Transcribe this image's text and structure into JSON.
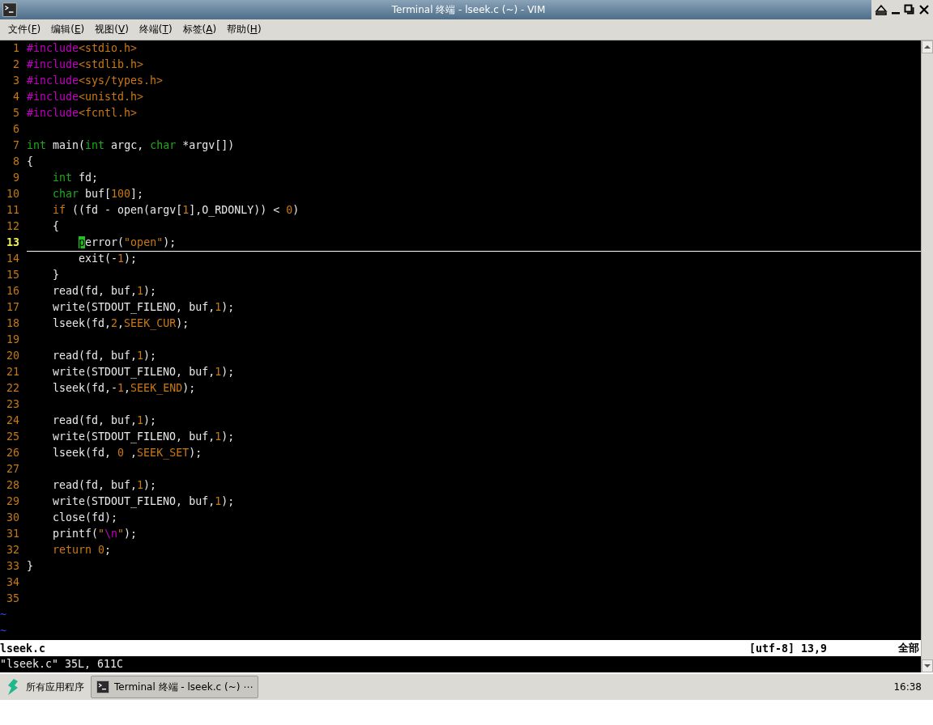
{
  "window": {
    "title": "Terminal 终端 - lseek.c (~) - VIM"
  },
  "menu": [
    {
      "before": "文件(",
      "key": "F",
      "after": ")"
    },
    {
      "before": "编辑(",
      "key": "E",
      "after": ")"
    },
    {
      "before": "视图(",
      "key": "V",
      "after": ")"
    },
    {
      "before": "终端(",
      "key": "T",
      "after": ")"
    },
    {
      "before": "标签(",
      "key": "A",
      "after": ")"
    },
    {
      "before": "帮助(",
      "key": "H",
      "after": ")"
    }
  ],
  "editor": {
    "lines": [
      {
        "number": "1",
        "current": false,
        "tokens": [
          {
            "text": "#include",
            "kind": "preproc"
          },
          {
            "text": "<stdio.h>",
            "kind": "string"
          }
        ]
      },
      {
        "number": "2",
        "current": false,
        "tokens": [
          {
            "text": "#include",
            "kind": "preproc"
          },
          {
            "text": "<stdlib.h>",
            "kind": "string"
          }
        ]
      },
      {
        "number": "3",
        "current": false,
        "tokens": [
          {
            "text": "#include",
            "kind": "preproc"
          },
          {
            "text": "<sys/types.h>",
            "kind": "string"
          }
        ]
      },
      {
        "number": "4",
        "current": false,
        "tokens": [
          {
            "text": "#include",
            "kind": "preproc"
          },
          {
            "text": "<unistd.h>",
            "kind": "string"
          }
        ]
      },
      {
        "number": "5",
        "current": false,
        "tokens": [
          {
            "text": "#include",
            "kind": "preproc"
          },
          {
            "text": "<fcntl.h>",
            "kind": "string"
          }
        ]
      },
      {
        "number": "6",
        "current": false
      },
      {
        "number": "7",
        "current": false,
        "tokens": [
          {
            "text": "int",
            "kind": "type"
          },
          {
            "text": " main(",
            "kind": "plain"
          },
          {
            "text": "int",
            "kind": "type"
          },
          {
            "text": " argc, ",
            "kind": "plain"
          },
          {
            "text": "char",
            "kind": "type"
          },
          {
            "text": " *argv[])",
            "kind": "plain"
          }
        ]
      },
      {
        "number": "8",
        "current": false,
        "tokens": [
          {
            "text": "{",
            "kind": "plain"
          }
        ]
      },
      {
        "number": "9",
        "current": false,
        "tokens": [
          {
            "text": "    int",
            "kind": "type"
          },
          {
            "text": " fd;",
            "kind": "plain"
          }
        ]
      },
      {
        "number": "10",
        "current": false,
        "tokens": [
          {
            "text": "    char",
            "kind": "type"
          },
          {
            "text": " buf[",
            "kind": "plain"
          },
          {
            "text": "100",
            "kind": "number"
          },
          {
            "text": "];",
            "kind": "plain"
          }
        ]
      },
      {
        "number": "11",
        "current": false,
        "tokens": [
          {
            "text": "    if",
            "kind": "statement"
          },
          {
            "text": " ((fd - open(argv[",
            "kind": "plain"
          },
          {
            "text": "1",
            "kind": "number"
          },
          {
            "text": "],O_RDONLY)) < ",
            "kind": "plain"
          },
          {
            "text": "0",
            "kind": "number"
          },
          {
            "text": ")",
            "kind": "plain"
          }
        ]
      },
      {
        "number": "12",
        "current": false,
        "tokens": [
          {
            "text": "    {",
            "kind": "plain"
          }
        ]
      },
      {
        "number": "13",
        "current": true,
        "tokens": [
          {
            "text": "        p",
            "kind": "cursor"
          },
          {
            "text": "error(",
            "kind": "plain"
          },
          {
            "text": "\"open\"",
            "kind": "string"
          },
          {
            "text": ");",
            "kind": "plain"
          }
        ]
      },
      {
        "number": "14",
        "current": false,
        "tokens": [
          {
            "text": "        exit(-",
            "kind": "plain"
          },
          {
            "text": "1",
            "kind": "number"
          },
          {
            "text": ");",
            "kind": "plain"
          }
        ]
      },
      {
        "number": "15",
        "current": false,
        "tokens": [
          {
            "text": "    }",
            "kind": "plain"
          }
        ]
      },
      {
        "number": "16",
        "current": false,
        "tokens": [
          {
            "text": "    read(fd, buf,",
            "kind": "plain"
          },
          {
            "text": "1",
            "kind": "number"
          },
          {
            "text": ");",
            "kind": "plain"
          }
        ]
      },
      {
        "number": "17",
        "current": false,
        "tokens": [
          {
            "text": "    write(STDOUT_FILENO, buf,",
            "kind": "plain"
          },
          {
            "text": "1",
            "kind": "number"
          },
          {
            "text": ");",
            "kind": "plain"
          }
        ]
      },
      {
        "number": "18",
        "current": false,
        "tokens": [
          {
            "text": "    lseek(fd,",
            "kind": "plain"
          },
          {
            "text": "2",
            "kind": "number"
          },
          {
            "text": ",",
            "kind": "plain"
          },
          {
            "text": "SEEK_CUR",
            "kind": "constant"
          },
          {
            "text": ");",
            "kind": "plain"
          }
        ]
      },
      {
        "number": "19",
        "current": false
      },
      {
        "number": "20",
        "current": false,
        "tokens": [
          {
            "text": "    read(fd, buf,",
            "kind": "plain"
          },
          {
            "text": "1",
            "kind": "number"
          },
          {
            "text": ");",
            "kind": "plain"
          }
        ]
      },
      {
        "number": "21",
        "current": false,
        "tokens": [
          {
            "text": "    write(STDOUT_FILENO, buf,",
            "kind": "plain"
          },
          {
            "text": "1",
            "kind": "number"
          },
          {
            "text": ");",
            "kind": "plain"
          }
        ]
      },
      {
        "number": "22",
        "current": false,
        "tokens": [
          {
            "text": "    lseek(fd,-",
            "kind": "plain"
          },
          {
            "text": "1",
            "kind": "number"
          },
          {
            "text": ",",
            "kind": "plain"
          },
          {
            "text": "SEEK_END",
            "kind": "constant"
          },
          {
            "text": ");",
            "kind": "plain"
          }
        ]
      },
      {
        "number": "23",
        "current": false
      },
      {
        "number": "24",
        "current": false,
        "tokens": [
          {
            "text": "    read(fd, buf,",
            "kind": "plain"
          },
          {
            "text": "1",
            "kind": "number"
          },
          {
            "text": ");",
            "kind": "plain"
          }
        ]
      },
      {
        "number": "25",
        "current": false,
        "tokens": [
          {
            "text": "    write(STDOUT_FILENO, buf,",
            "kind": "plain"
          },
          {
            "text": "1",
            "kind": "number"
          },
          {
            "text": ");",
            "kind": "plain"
          }
        ]
      },
      {
        "number": "26",
        "current": false,
        "tokens": [
          {
            "text": "    lseek(fd, ",
            "kind": "plain"
          },
          {
            "text": "0",
            "kind": "number"
          },
          {
            "text": " ,",
            "kind": "plain"
          },
          {
            "text": "SEEK_SET",
            "kind": "constant"
          },
          {
            "text": ");",
            "kind": "plain"
          }
        ]
      },
      {
        "number": "27",
        "current": false
      },
      {
        "number": "28",
        "current": false,
        "tokens": [
          {
            "text": "    read(fd, buf,",
            "kind": "plain"
          },
          {
            "text": "1",
            "kind": "number"
          },
          {
            "text": ");",
            "kind": "plain"
          }
        ]
      },
      {
        "number": "29",
        "current": false,
        "tokens": [
          {
            "text": "    write(STDOUT_FILENO, buf,",
            "kind": "plain"
          },
          {
            "text": "1",
            "kind": "number"
          },
          {
            "text": ");",
            "kind": "plain"
          }
        ]
      },
      {
        "number": "30",
        "current": false,
        "tokens": [
          {
            "text": "    close(fd);",
            "kind": "plain"
          }
        ]
      },
      {
        "number": "31",
        "current": false,
        "tokens": [
          {
            "text": "    printf(",
            "kind": "plain"
          },
          {
            "text": "\"",
            "kind": "string"
          },
          {
            "text": "\\n",
            "kind": "special"
          },
          {
            "text": "\"",
            "kind": "string"
          },
          {
            "text": ");",
            "kind": "plain"
          }
        ]
      },
      {
        "number": "32",
        "current": false,
        "tokens": [
          {
            "text": "    return",
            "kind": "statement"
          },
          {
            "text": " 0",
            "kind": "number"
          },
          {
            "text": ";",
            "kind": "plain"
          }
        ]
      },
      {
        "number": "33",
        "current": false,
        "tokens": [
          {
            "text": "}",
            "kind": "plain"
          }
        ]
      },
      {
        "number": "34",
        "current": false
      },
      {
        "number": "35",
        "current": false
      }
    ],
    "filler": [
      "~",
      "~"
    ]
  },
  "status_line": {
    "file": "lseek.c",
    "position": "[utf-8] 13,9",
    "scroll": "全部"
  },
  "command_line": "\"lseek.c\" 35L, 611C",
  "taskbar": {
    "start_label": "所有应用程序",
    "tasks": [
      {
        "label": "Terminal 终端 - lseek.c (~) ⋯",
        "selected": true
      }
    ],
    "clock": "16:38"
  }
}
